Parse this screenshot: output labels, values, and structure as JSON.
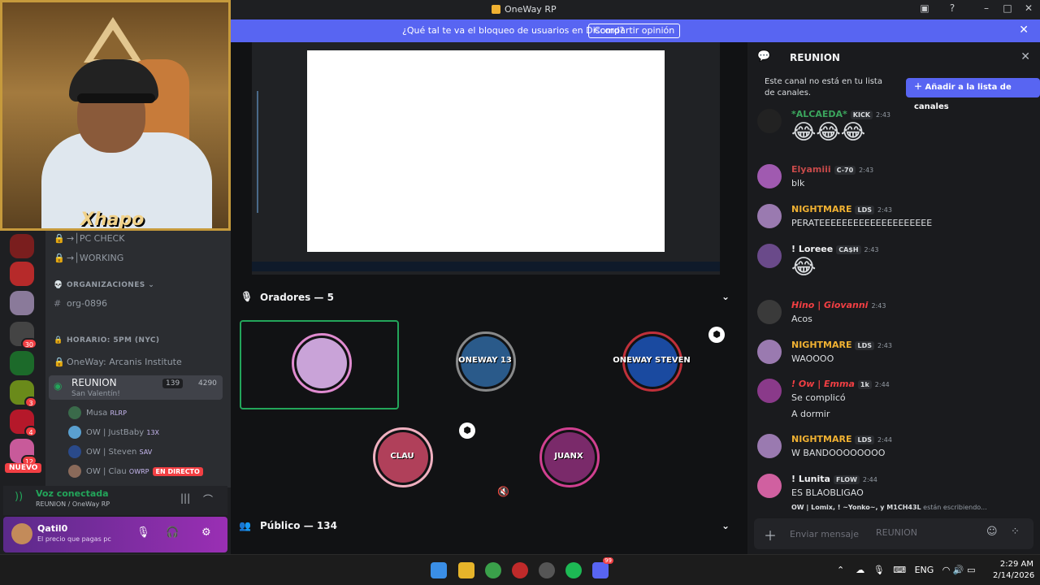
{
  "window": {
    "title": "OneWay RP"
  },
  "banner": {
    "text": "¿Qué tal te va el bloqueo de usuarios en Discord?",
    "button": "Compartir opinión"
  },
  "webcam": {
    "name": "Xhapo"
  },
  "rail": {
    "badges": [
      "30",
      "3",
      "4",
      "12"
    ],
    "new_label": "NUEVO"
  },
  "channels": {
    "items": [
      {
        "label": "→│PC CHECK",
        "icon": "lock-icon"
      },
      {
        "label": "→│WORKING",
        "icon": "lock-icon"
      },
      {
        "label": "ORGANIZACIONES",
        "icon": "skull-icon"
      },
      {
        "label": "org-0896",
        "icon": "hash-icon"
      },
      {
        "label": "HORARIO: 5PM (NYC)",
        "icon": "lock-icon"
      },
      {
        "label": "OneWay: Arcanis Institute",
        "icon": "lock-icon"
      }
    ],
    "voice": {
      "name": "REUNION",
      "status": "San Valentín!",
      "count_a": "139",
      "count_b": "4290"
    },
    "voice_users": [
      {
        "name": "Musa",
        "tag": "RLRP"
      },
      {
        "name": "OW | JustBaby",
        "tag": "13X"
      },
      {
        "name": "OW | Steven",
        "tag": "SAV"
      },
      {
        "name": "OW | Clau",
        "tag": "OWRP",
        "live": "EN DIRECTO"
      }
    ]
  },
  "voice_panel": {
    "status": "Voz conectada",
    "channel": "REUNION / OneWay RP"
  },
  "user_panel": {
    "name": "Qatil0",
    "status": "El precio que pagas pc"
  },
  "stage": {
    "speakers_label": "Oradores — 5",
    "audience_label": "Público — 134",
    "tiles": [
      {
        "label": "",
        "color": "#e6d6da"
      },
      {
        "label": "ONEWAY 13",
        "color": "#3cc3ec"
      },
      {
        "label": "ONEWAY STEVEN",
        "color": "#1b2a5e"
      },
      {
        "label": "CLAU",
        "color": "#6b4f58"
      },
      {
        "label": "JUANX",
        "color": "#5a1a1e"
      }
    ]
  },
  "chat": {
    "title": "REUNION",
    "notice": "Este canal no está en tu lista de canales.",
    "notice_button": "Añadir a la lista de canales",
    "messages": [
      {
        "name": "*ALCAEDA*",
        "tag": "KICK",
        "time": "2:43",
        "emoji": "😂😂😂",
        "color": "#3ba55d"
      },
      {
        "name": "Elyamiii",
        "tag": "C-70",
        "time": "2:43",
        "text": "blk",
        "color": "#c74a4a"
      },
      {
        "name": "NIGHTMARE",
        "tag": "LDS",
        "time": "2:43",
        "text": "PERATEEEEEEEEEEEEEEEEEEEE",
        "color": "#f0b132"
      },
      {
        "name": "! Loreee",
        "tag": "CA$H",
        "time": "2:43",
        "emoji": "😂",
        "color": "#f2f3f5"
      },
      {
        "name": "Hino | Giovanni",
        "tag": "",
        "time": "2:43",
        "text": "Acos",
        "color": "#f23f43"
      },
      {
        "name": "NIGHTMARE",
        "tag": "LDS",
        "time": "2:43",
        "text": "WAOOOO",
        "color": "#f0b132"
      },
      {
        "name": "! Ow | Emma",
        "tag": "1k",
        "time": "2:44",
        "text": "Se complicó",
        "text2": "A dormir",
        "color": "#f23f43"
      },
      {
        "name": "NIGHTMARE",
        "tag": "LDS",
        "time": "2:44",
        "text": "W BANDOOOOOOOO",
        "color": "#f0b132"
      },
      {
        "name": "! Lunita",
        "tag": "FLOW",
        "time": "2:44",
        "text": "ES BLAOBLIGAO",
        "color": "#f2f3f5"
      }
    ],
    "typing": "OW | Lomix, ! ~Yonko~, y M1CH43L",
    "typing_suffix": "están escribiendo...",
    "input_placeholder": "Enviar mensaje",
    "input_channel": "REUNION"
  },
  "taskbar": {
    "lang": "ENG",
    "time": "2:29 AM",
    "date": "2/14/2026",
    "discord_badge": "99"
  }
}
